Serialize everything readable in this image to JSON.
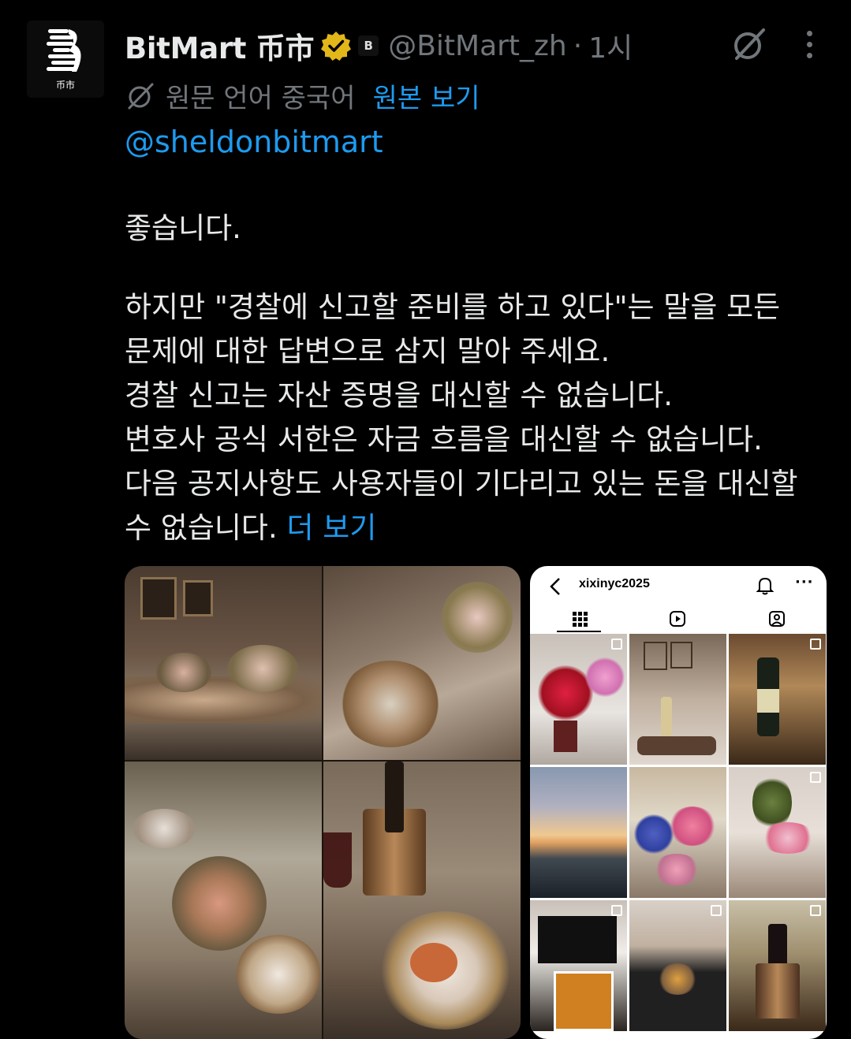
{
  "author": {
    "display_name": "BitMart 币市",
    "handle": "@BitMart_zh",
    "separator": "·",
    "time": "1시",
    "avatar_sub_label": "币市",
    "affiliate_badge_letter": "B"
  },
  "translation": {
    "label": "원문 언어 중국어",
    "show_original": "원본 보기"
  },
  "mention": "@sheldonbitmart",
  "body": {
    "first_line": "좋습니다.",
    "lines": [
      "하지만 \"경찰에 신고할 준비를 하고 있다\"는 말을 모든",
      "문제에 대한 답변으로 삼지 말아 주세요.",
      "경찰 신고는 자산 증명을 대신할 수 없습니다.",
      "변호사 공식 서한은 자금 흐름을 대신할 수 없습니다.",
      "다음 공지사항도 사용자들이 기다리고 있는 돈을 대신할"
    ],
    "last_line": "수 없습니다.",
    "show_more": "더 보기"
  },
  "media": {
    "instagram": {
      "username": "xixinyc2025",
      "more": "···"
    }
  },
  "colors": {
    "background": "#000000",
    "text": "#e7e9ea",
    "muted": "#71767b",
    "link": "#1d9bf0",
    "verified_gold": "#e2b719"
  }
}
